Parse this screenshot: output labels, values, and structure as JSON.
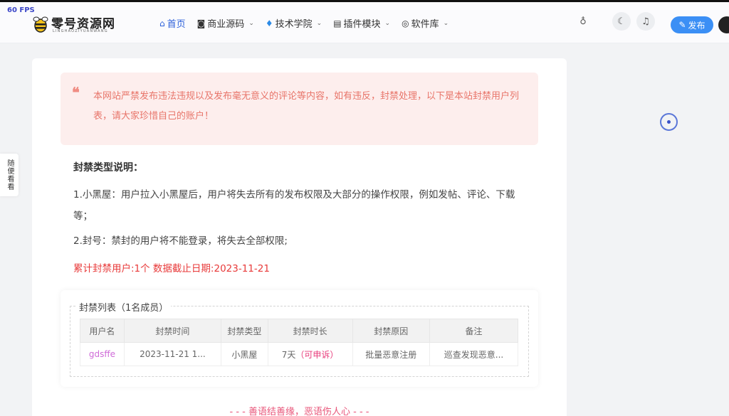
{
  "overlay": {
    "fps": "60 FPS"
  },
  "header": {
    "logo": {
      "name": "零号资源网",
      "sub": "LINGHAOZIYUANWANG"
    },
    "nav": [
      {
        "label": "首页",
        "icon": "home-icon",
        "active": true,
        "has_dropdown": false
      },
      {
        "label": "商业源码",
        "icon": "code-icon",
        "active": false,
        "has_dropdown": true
      },
      {
        "label": "技术学院",
        "icon": "diamond-icon",
        "active": false,
        "has_dropdown": true
      },
      {
        "label": "插件模块",
        "icon": "module-icon",
        "active": false,
        "has_dropdown": true
      },
      {
        "label": "软件库",
        "icon": "software-icon",
        "active": false,
        "has_dropdown": true
      }
    ],
    "publish_label": "发布"
  },
  "side_tab": {
    "label": "随便看看"
  },
  "notice": {
    "text": "本网站严禁发布违法违规以及发布毫无意义的评论等内容，如有违反，封禁处理，以下是本站封禁用户列表，请大家珍惜自己的账户！"
  },
  "explanation": {
    "title": "封禁类型说明：",
    "item1": "1.小黑屋：用户拉入小黑屋后，用户将失去所有的发布权限及大部分的操作权限，例如发帖、评论、下载等；",
    "item2": "2.封号：禁封的用户将不能登录，将失去全部权限;",
    "stats": "累计封禁用户:1个 数据截止日期:2023-11-21"
  },
  "banlist": {
    "legend": "封禁列表（1名成员）",
    "columns": [
      "用户名",
      "封禁时间",
      "封禁类型",
      "封禁时长",
      "封禁原因",
      "备注"
    ],
    "rows": [
      {
        "username": "gdsffe",
        "time": "2023-11-21 1...",
        "type": "小黑屋",
        "duration": "7天",
        "appeal": "（可申诉）",
        "reason": "批量恶意注册",
        "remark": "巡查发现恶意..."
      }
    ]
  },
  "footer_note": "- - - 善语结善缘，恶语伤人心 - - -",
  "colors": {
    "accent": "#2b5fd9",
    "publish": "#3b8ff5",
    "warning_text": "#e83a3a",
    "notice_bg": "#fdeeed"
  }
}
